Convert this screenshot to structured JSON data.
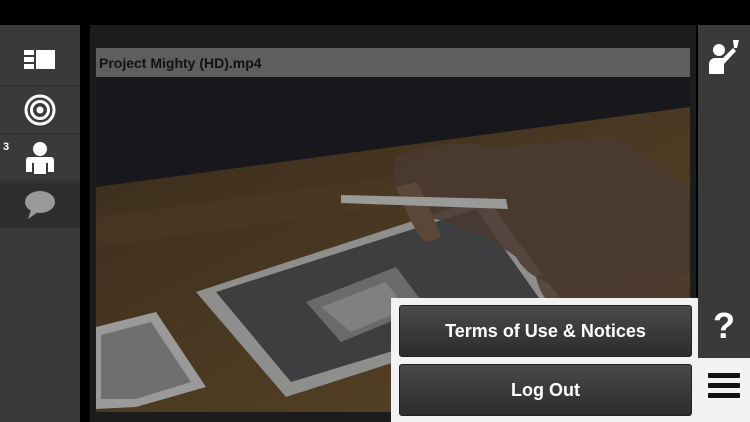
{
  "sidebar": {
    "items": [
      {
        "icon": "layout-icon"
      },
      {
        "icon": "target-icon"
      },
      {
        "icon": "participants-icon",
        "badge": "3"
      },
      {
        "icon": "chat-bubble-icon"
      }
    ]
  },
  "video": {
    "title": "Project Mighty (HD).mp4"
  },
  "right_sidebar": {
    "top_icon": "raise-hand-icon",
    "help_label": "?",
    "menu_icon": "hamburger-menu-icon"
  },
  "menu": {
    "terms_label": "Terms of Use & Notices",
    "logout_label": "Log Out"
  },
  "colors": {
    "sidebar": "#3a3a3a",
    "menu_background": "#f2f2f2",
    "button_dark": "#3a3a3a"
  }
}
